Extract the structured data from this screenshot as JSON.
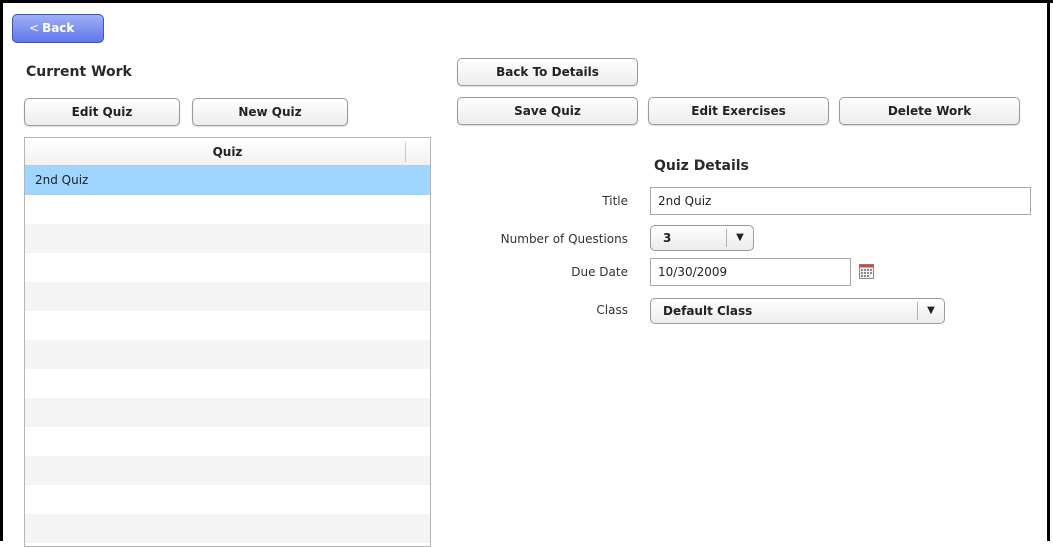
{
  "header": {
    "back_label": "Back"
  },
  "left": {
    "title": "Current Work",
    "edit_quiz_label": "Edit Quiz",
    "new_quiz_label": "New Quiz",
    "list_header": "Quiz",
    "rows": [
      "2nd Quiz",
      "",
      "",
      "",
      "",
      "",
      "",
      "",
      "",
      "",
      "",
      "",
      ""
    ]
  },
  "toolbar": {
    "back_to_details_label": "Back To Details",
    "save_quiz_label": "Save Quiz",
    "edit_exercises_label": "Edit Exercises",
    "delete_work_label": "Delete Work"
  },
  "details": {
    "title": "Quiz Details",
    "title_label": "Title",
    "title_value": "2nd Quiz",
    "questions_label": "Number of Questions",
    "questions_value": "3",
    "due_label": "Due Date",
    "due_value": "10/30/2009",
    "class_label": "Class",
    "class_value": "Default Class"
  },
  "icons": {
    "calendar": "calendar-icon",
    "dropdown": "chevron-down-icon",
    "back": "chevron-left-icon"
  },
  "colors": {
    "back_button": "#5f76e8",
    "selected_row": "#9fd6ff"
  }
}
